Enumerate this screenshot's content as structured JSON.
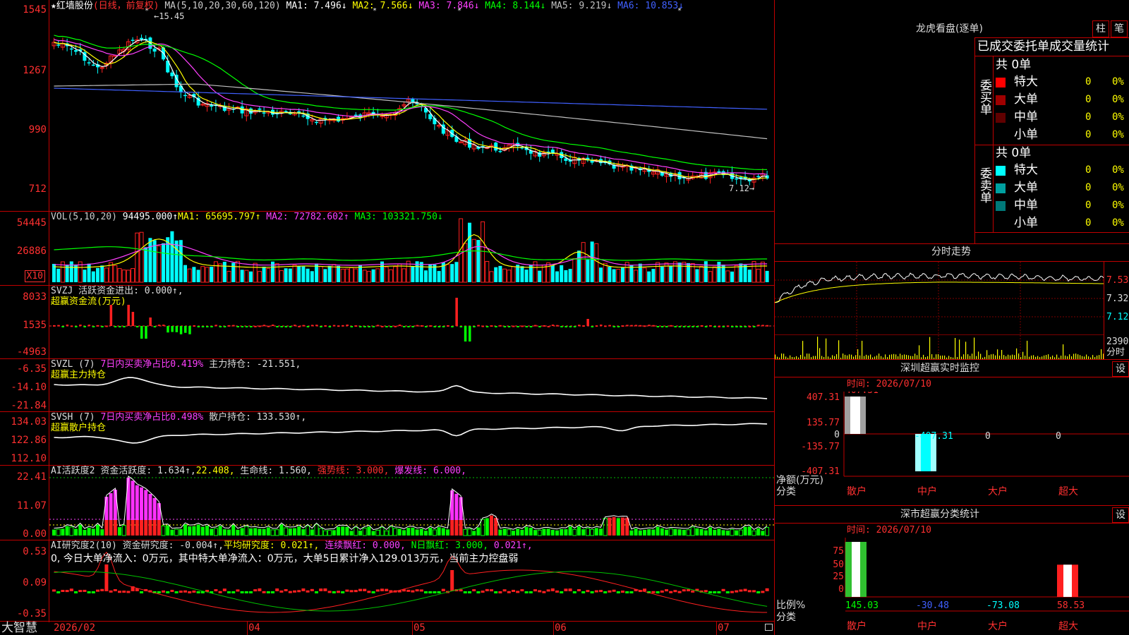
{
  "kline": {
    "stock": "★红墙股份",
    "period": "(日线，前复权)",
    "ma_params": "MA(5,10,20,30,60,120)",
    "ma1": "MA1: 7.496↓",
    "ma2": "MA2: 7.566↓",
    "ma3": "MA3: 7.846↓",
    "ma4": "MA4: 8.144↓",
    "ma5": "MA5: 9.219↓",
    "ma6": "MA6: 10.853↓",
    "peak_label": "15.45",
    "trough_label": "7.12→",
    "y_labels": [
      "1545",
      "1267",
      "990",
      "712"
    ],
    "colors": {
      "ma1": "#ffffff",
      "ma2": "#ffff00",
      "ma3": "#ff40ff",
      "ma4": "#00ff00",
      "ma5": "#c0c0c0",
      "ma6": "#4060ff",
      "up": "#ff2020",
      "down": "#00ffff"
    }
  },
  "vol": {
    "title": "VOL(5,10,20)",
    "value": "94495.000↑",
    "ma1": "MA1: 65695.797↑",
    "ma2": "MA2: 72782.602↑",
    "ma3": "MA3: 103321.750↓",
    "y_labels": [
      "54445",
      "26886"
    ],
    "unit": "X10"
  },
  "svzj": {
    "line1": "SVZJ  活跃资金进出: 0.000↑,",
    "line2": "超赢资金流(万元)",
    "y_labels": [
      "8033",
      "1535",
      "-4963"
    ]
  },
  "svzl": {
    "prefix": "SVZL (7)",
    "pct": "7日内买卖净占比0.419%",
    "rest": "主力持仓: -21.551,",
    "line2": "超赢主力持仓",
    "y_labels": [
      "-6.35",
      "-14.10",
      "-21.84"
    ]
  },
  "svsh": {
    "prefix": "SVSH (7)",
    "pct": "7日内买卖净占比0.498%",
    "rest": "散户持仓: 133.530↑,",
    "line2": "超赢散户持仓",
    "y_labels": [
      "134.03",
      "122.86",
      "112.10"
    ]
  },
  "ai1": {
    "prefix": "AI活跃度2",
    "a": "资金活跃度: 1.634↑,",
    "b": "22.408,",
    "c": "生命线: 1.560,",
    "d": "强势线: 3.000,",
    "e": "爆发线: 6.000,",
    "y_labels": [
      "22.41",
      "11.07",
      "0.00"
    ]
  },
  "ai2": {
    "prefix": "AI研究度2(10)",
    "a": "资金研究度: -0.004↑,",
    "b": "平均研究度: 0.021↑,",
    "c": "连续飘红: 0.000,",
    "d": "N日飘红: 3.000,",
    "e": "0.021↑,",
    "line2": "0, 今日大单净流入：0万元，其中特大单净流入：0万元，大单5日累计净入129.013万元，当前主力控盘弱",
    "y_labels": [
      "0.53",
      "0.09",
      "-0.35"
    ]
  },
  "dates": [
    "2026/02",
    "04",
    "05",
    "06",
    "07"
  ],
  "logo": "大智慧",
  "lhb": {
    "title": "龙虎看盘(逐单)",
    "btn1": "柱",
    "btn2": "笔",
    "subtitle": "已成交委托单成交量统计",
    "buy_label": "委买单",
    "sell_label": "委卖单",
    "buy_total": "共 0单",
    "sell_total": "共 0单",
    "buy_rows": [
      {
        "name": "特大",
        "count": "0",
        "pct": "0%",
        "color": "#ff0000"
      },
      {
        "name": "大单",
        "count": "0",
        "pct": "0%",
        "color": "#a00000"
      },
      {
        "name": "中单",
        "count": "0",
        "pct": "0%",
        "color": "#600000"
      },
      {
        "name": "小单",
        "count": "0",
        "pct": "0%",
        "color": "#000000"
      }
    ],
    "sell_rows": [
      {
        "name": "特大",
        "count": "0",
        "pct": "0%",
        "color": "#00ffff"
      },
      {
        "name": "大单",
        "count": "0",
        "pct": "0%",
        "color": "#00a0a0"
      },
      {
        "name": "中单",
        "count": "0",
        "pct": "0%",
        "color": "#007878"
      },
      {
        "name": "小单",
        "count": "0",
        "pct": "0%",
        "color": "#000000"
      }
    ]
  },
  "fenshi": {
    "title": "分时走势",
    "y_labels": [
      "7.53",
      "7.32",
      "7.12"
    ],
    "vol_label": "2390",
    "vol_unit": "分时"
  },
  "sz_monitor": {
    "title": "深圳超赢实时监控",
    "btn": "设",
    "time": "时间: 2026/07/10",
    "top_value": "407.31",
    "y_labels": [
      "407.31",
      "135.77",
      "0",
      "-135.77",
      "-407.31"
    ],
    "values": [
      "-407.31",
      "0",
      "0"
    ],
    "axis_title": "净额(万元)",
    "axis_sub": "分类",
    "categories": [
      "散户",
      "中户",
      "大户",
      "超大"
    ]
  },
  "sz_stats": {
    "title": "深市超赢分类统计",
    "btn": "设",
    "time": "时间: 2026/07/10",
    "y_labels": [
      "75",
      "50",
      "25",
      "0"
    ],
    "values": [
      "145.03",
      "-30.48",
      "-73.08",
      "58.53"
    ],
    "axis_title": "比例%",
    "axis_sub": "分类",
    "categories": [
      "散户",
      "中户",
      "大户",
      "超大"
    ]
  }
}
